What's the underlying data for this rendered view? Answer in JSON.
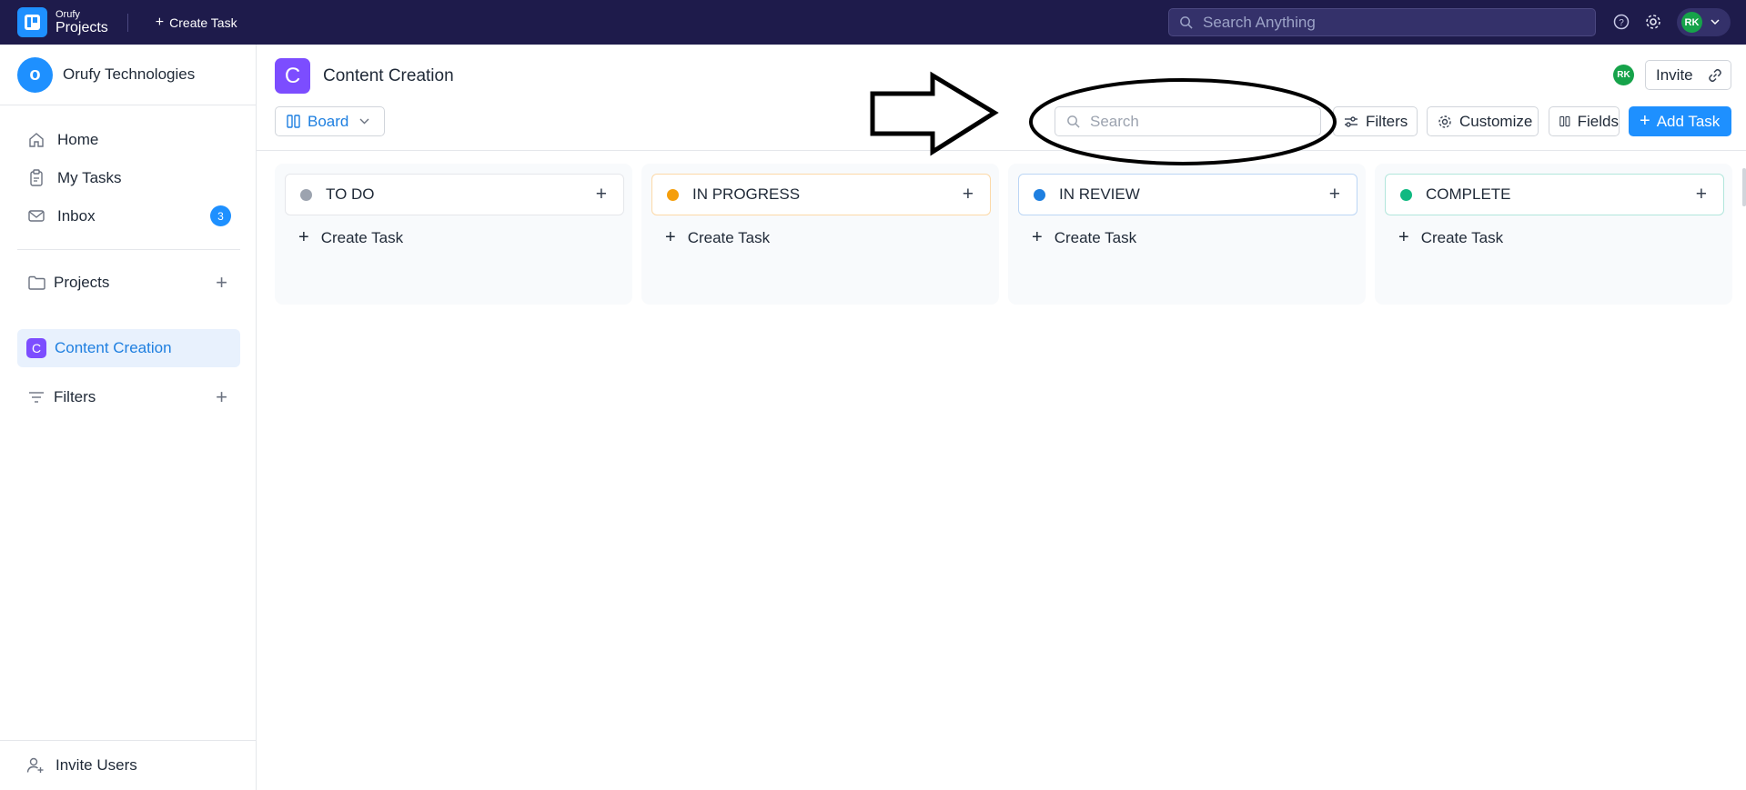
{
  "topbar": {
    "brand_small": "Orufy",
    "brand_big": "Projects",
    "create_task_label": "Create Task",
    "search_placeholder": "Search Anything",
    "user_initials": "RK",
    "icons": [
      "help-icon",
      "gear-icon",
      "chevron-down-icon"
    ]
  },
  "sidebar": {
    "org_initial": "o",
    "org_name": "Orufy Technologies",
    "nav": [
      {
        "label": "Home",
        "icon": "home-icon"
      },
      {
        "label": "My Tasks",
        "icon": "clipboard-icon"
      },
      {
        "label": "Inbox",
        "icon": "mail-icon",
        "badge": "3"
      }
    ],
    "projects_label": "Projects",
    "active_project": {
      "initial": "C",
      "label": "Content Creation"
    },
    "filters_label": "Filters",
    "invite_users_label": "Invite Users"
  },
  "header": {
    "project_initial": "C",
    "project_title": "Content Creation",
    "member_initials": "RK",
    "invite_label": "Invite"
  },
  "toolbar": {
    "view_label": "Board",
    "search_placeholder": "Search",
    "filters_label": "Filters",
    "customize_label": "Customize",
    "fields_label": "Fields",
    "add_task_label": "Add Task"
  },
  "columns": [
    {
      "title": "TO DO",
      "dot_color": "#9ca3af",
      "border_color": "#e5e7eb",
      "create_label": "Create Task"
    },
    {
      "title": "IN PROGRESS",
      "dot_color": "#f59e0b",
      "border_color": "#fcd9a8",
      "create_label": "Create Task"
    },
    {
      "title": "IN REVIEW",
      "dot_color": "#1e7fe0",
      "border_color": "#bcd6f5",
      "create_label": "Create Task"
    },
    {
      "title": "COMPLETE",
      "dot_color": "#10b981",
      "border_color": "#b2e6dc",
      "create_label": "Create Task"
    }
  ],
  "colors": {
    "topbar_bg": "#1e1b4b",
    "accent": "#1e90ff",
    "project_purple": "#7c4dff",
    "avatar_green": "#16a34a"
  }
}
